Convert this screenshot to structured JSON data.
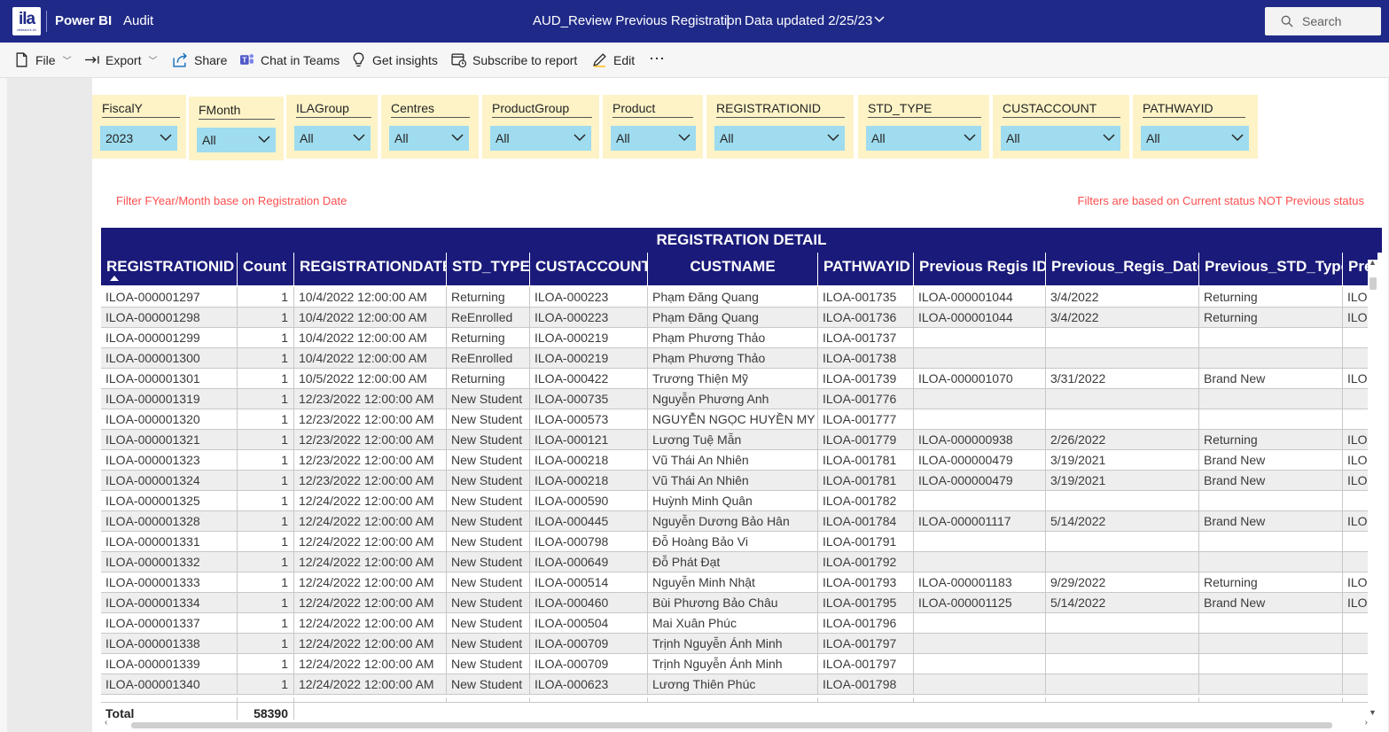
{
  "header": {
    "logo_text": "ila",
    "logo_sub": "vietnam's #1",
    "app_name": "Power BI",
    "workspace": "Audit",
    "report_title": "AUD_Review Previous Registration",
    "title_separator": "|",
    "data_updated": "Data updated 2/25/23",
    "search_placeholder": "Search"
  },
  "actions": {
    "file": "File",
    "export": "Export",
    "share": "Share",
    "chat": "Chat in Teams",
    "insights": "Get insights",
    "subscribe": "Subscribe to report",
    "edit": "Edit",
    "more": "⋯"
  },
  "slicers": [
    {
      "label": "FiscalY",
      "value": "2023"
    },
    {
      "label": "FMonth",
      "value": "All"
    },
    {
      "label": "ILAGroup",
      "value": "All"
    },
    {
      "label": "Centres",
      "value": "All"
    },
    {
      "label": "ProductGroup",
      "value": "All"
    },
    {
      "label": "Product",
      "value": "All"
    },
    {
      "label": "REGISTRATIONID",
      "value": "All"
    },
    {
      "label": "STD_TYPE",
      "value": "All"
    },
    {
      "label": "CUSTACCOUNT",
      "value": "All"
    },
    {
      "label": "PATHWAYID",
      "value": "All"
    }
  ],
  "notes": {
    "left": "Filter FYear/Month base on Registration Date",
    "right": "Filters are based on Current status NOT Previous status"
  },
  "table": {
    "title": "REGISTRATION DETAIL",
    "columns": [
      "REGISTRATIONID",
      "Count",
      "REGISTRATIONDATE",
      "STD_TYPE",
      "CUSTACCOUNT",
      "CUSTNAME",
      "PATHWAYID",
      "Previous Regis ID",
      "Previous_Regis_Date",
      "Previous_STD_Type",
      "Pre"
    ],
    "rows": [
      [
        "ILOA-000001297",
        "1",
        "10/4/2022 12:00:00 AM",
        "Returning",
        "ILOA-000223",
        "Phạm Đăng Quang",
        "ILOA-001735",
        "ILOA-000001044",
        "3/4/2022",
        "Returning",
        "ILO"
      ],
      [
        "ILOA-000001298",
        "1",
        "10/4/2022 12:00:00 AM",
        "ReEnrolled",
        "ILOA-000223",
        "Phạm Đăng Quang",
        "ILOA-001736",
        "ILOA-000001044",
        "3/4/2022",
        "Returning",
        "ILO"
      ],
      [
        "ILOA-000001299",
        "1",
        "10/4/2022 12:00:00 AM",
        "Returning",
        "ILOA-000219",
        "Phạm Phương Thảo",
        "ILOA-001737",
        "",
        "",
        "",
        ""
      ],
      [
        "ILOA-000001300",
        "1",
        "10/4/2022 12:00:00 AM",
        "ReEnrolled",
        "ILOA-000219",
        "Phạm Phương Thảo",
        "ILOA-001738",
        "",
        "",
        "",
        ""
      ],
      [
        "ILOA-000001301",
        "1",
        "10/5/2022 12:00:00 AM",
        "Returning",
        "ILOA-000422",
        "Trương Thiện Mỹ",
        "ILOA-001739",
        "ILOA-000001070",
        "3/31/2022",
        "Brand New",
        "ILO"
      ],
      [
        "ILOA-000001319",
        "1",
        "12/23/2022 12:00:00 AM",
        "New Student",
        "ILOA-000735",
        "Nguyễn Phương Anh",
        "ILOA-001776",
        "",
        "",
        "",
        ""
      ],
      [
        "ILOA-000001320",
        "1",
        "12/23/2022 12:00:00 AM",
        "New Student",
        "ILOA-000573",
        "NGUYỄN NGỌC HUYỀN MY",
        "ILOA-001777",
        "",
        "",
        "",
        ""
      ],
      [
        "ILOA-000001321",
        "1",
        "12/23/2022 12:00:00 AM",
        "New Student",
        "ILOA-000121",
        "Lương Tuệ Mẫn",
        "ILOA-001779",
        "ILOA-000000938",
        "2/26/2022",
        "Returning",
        "ILO"
      ],
      [
        "ILOA-000001323",
        "1",
        "12/23/2022 12:00:00 AM",
        "New Student",
        "ILOA-000218",
        "Vũ Thái An Nhiên",
        "ILOA-001781",
        "ILOA-000000479",
        "3/19/2021",
        "Brand New",
        "ILO"
      ],
      [
        "ILOA-000001324",
        "1",
        "12/23/2022 12:00:00 AM",
        "New Student",
        "ILOA-000218",
        "Vũ Thái An Nhiên",
        "ILOA-001781",
        "ILOA-000000479",
        "3/19/2021",
        "Brand New",
        "ILO"
      ],
      [
        "ILOA-000001325",
        "1",
        "12/24/2022 12:00:00 AM",
        "New Student",
        "ILOA-000590",
        "Huỳnh Minh Quân",
        "ILOA-001782",
        "",
        "",
        "",
        ""
      ],
      [
        "ILOA-000001328",
        "1",
        "12/24/2022 12:00:00 AM",
        "New Student",
        "ILOA-000445",
        "Nguyễn Dương Bảo Hân",
        "ILOA-001784",
        "ILOA-000001117",
        "5/14/2022",
        "Brand New",
        "ILO"
      ],
      [
        "ILOA-000001331",
        "1",
        "12/24/2022 12:00:00 AM",
        "New Student",
        "ILOA-000798",
        "Đỗ Hoàng Bảo Vi",
        "ILOA-001791",
        "",
        "",
        "",
        ""
      ],
      [
        "ILOA-000001332",
        "1",
        "12/24/2022 12:00:00 AM",
        "New Student",
        "ILOA-000649",
        "Đỗ Phát Đạt",
        "ILOA-001792",
        "",
        "",
        "",
        ""
      ],
      [
        "ILOA-000001333",
        "1",
        "12/24/2022 12:00:00 AM",
        "New Student",
        "ILOA-000514",
        "Nguyễn Minh  Nhật",
        "ILOA-001793",
        "ILOA-000001183",
        "9/29/2022",
        "Returning",
        "ILO"
      ],
      [
        "ILOA-000001334",
        "1",
        "12/24/2022 12:00:00 AM",
        "New Student",
        "ILOA-000460",
        "Bùi Phương Bảo Châu",
        "ILOA-001795",
        "ILOA-000001125",
        "5/14/2022",
        "Brand New",
        "ILO"
      ],
      [
        "ILOA-000001337",
        "1",
        "12/24/2022 12:00:00 AM",
        "New Student",
        "ILOA-000504",
        "Mai Xuân Phúc",
        "ILOA-001796",
        "",
        "",
        "",
        ""
      ],
      [
        "ILOA-000001338",
        "1",
        "12/24/2022 12:00:00 AM",
        "New Student",
        "ILOA-000709",
        "Trịnh Nguyễn Ánh Minh",
        "ILOA-001797",
        "",
        "",
        "",
        ""
      ],
      [
        "ILOA-000001339",
        "1",
        "12/24/2022 12:00:00 AM",
        "New Student",
        "ILOA-000709",
        "Trịnh Nguyễn Ánh Minh",
        "ILOA-001797",
        "",
        "",
        "",
        ""
      ],
      [
        "ILOA-000001340",
        "1",
        "12/24/2022 12:00:00 AM",
        "New Student",
        "ILOA-000623",
        "Lương Thiên Phúc",
        "ILOA-001798",
        "",
        "",
        "",
        ""
      ]
    ],
    "total_label": "Total",
    "total_count": "58390"
  },
  "colors": {
    "header_bg": "#1f2a88",
    "table_header_bg": "#1a1a7a",
    "slicer_bg": "#fdf3c7",
    "dropdown_bg": "#9fdcef",
    "note_text": "#ff4e4e"
  }
}
